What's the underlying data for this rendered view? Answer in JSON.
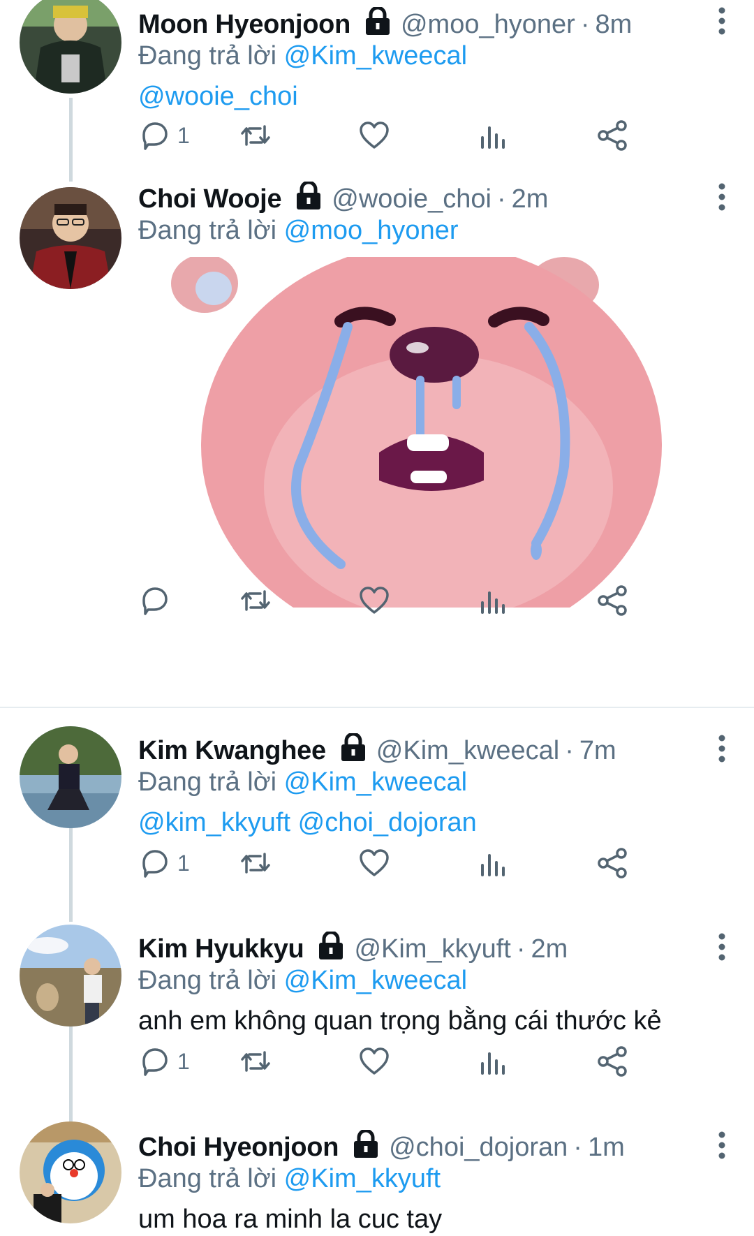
{
  "status_prefix": "Đang trả lời",
  "tweets": [
    {
      "name": "Moon Hyeonjoon",
      "handle": "@moo_hyoner",
      "time": "8m",
      "reply_to": "@Kim_kweecal",
      "text": "@wooie_choi",
      "reply_count": "1"
    },
    {
      "name": "Choi Wooje",
      "handle": "@wooie_choi",
      "time": "2m",
      "reply_to": "@moo_hyoner",
      "text": "",
      "reply_count": ""
    },
    {
      "name": "Kim Kwanghee",
      "handle": "@Kim_kweecal",
      "time": "7m",
      "reply_to": "@Kim_kweecal",
      "text": "@kim_kkyuft @choi_dojoran",
      "reply_count": "1"
    },
    {
      "name": "Kim Hyukkyu",
      "handle": "@Kim_kkyuft",
      "time": "2m",
      "reply_to": "@Kim_kweecal",
      "text": "anh em không quan trọng bằng cái thước kẻ",
      "reply_count": "1"
    },
    {
      "name": "Choi Hyeonjoon",
      "handle": "@choi_dojoran",
      "time": "1m",
      "reply_to": "@Kim_kkyuft",
      "text": "um hoa ra minh la cuc tay",
      "reply_count": ""
    }
  ],
  "icons": {
    "lock": "lock-icon",
    "more": "more-vertical-icon",
    "reply": "reply-icon",
    "retweet": "retweet-icon",
    "like": "heart-icon",
    "analytics": "analytics-icon",
    "share": "share-icon"
  },
  "colors": {
    "link": "#1d9bf0",
    "secondary": "#5b7083",
    "thread_line": "#cfd9de",
    "divider": "#e6ecf0"
  }
}
